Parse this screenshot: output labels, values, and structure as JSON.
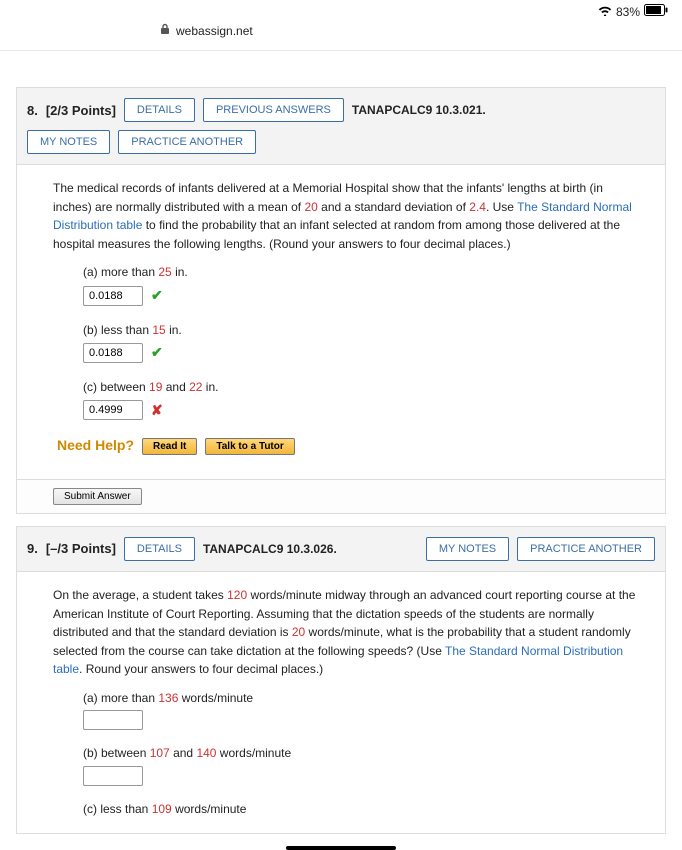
{
  "status": {
    "battery": "83%"
  },
  "address": "webassign.net",
  "buttons": {
    "details": "DETAILS",
    "previous_answers": "PREVIOUS ANSWERS",
    "my_notes": "MY NOTES",
    "practice_another": "PRACTICE ANOTHER"
  },
  "help": {
    "label": "Need Help?",
    "read": "Read It",
    "tutor": "Talk to a Tutor"
  },
  "submit_label": "Submit Answer",
  "q8": {
    "number": "8.",
    "points": "[2/3 Points]",
    "ref": "TANAPCALC9 10.3.021.",
    "text_pre": "The medical records of infants delivered at a Memorial Hospital show that the infants' lengths at birth (in inches) are normally distributed with a mean of ",
    "mean": "20",
    "text_mid1": " and a standard deviation of ",
    "sd": "2.4",
    "text_mid2": ". Use ",
    "link": "The Standard Normal Distribution table",
    "text_post": " to find the probability that an infant selected at random from among those delivered at the hospital measures the following lengths. (Round your answers to four decimal places.)",
    "a_pre": "(a) more than ",
    "a_val": "25",
    "a_unit": " in.",
    "a_ans": "0.0188",
    "b_pre": "(b) less than ",
    "b_val": "15",
    "b_unit": " in.",
    "b_ans": "0.0188",
    "c_pre": "(c) between ",
    "c_v1": "19",
    "c_mid": " and ",
    "c_v2": "22",
    "c_unit": " in.",
    "c_ans": "0.4999"
  },
  "q9": {
    "number": "9.",
    "points": "[–/3 Points]",
    "ref": "TANAPCALC9 10.3.026.",
    "t1": "On the average, a student takes ",
    "v1": "120",
    "t2": " words/minute midway through an advanced court reporting course at the American Institute of Court Reporting. Assuming that the dictation speeds of the students are normally distributed and that the standard deviation is ",
    "v2": "20",
    "t3": " words/minute, what is the probability that a student randomly selected from the course can take dictation at the following speeds? (Use ",
    "link": "The Standard Normal Distribution table",
    "t4": ". Round your answers to four decimal places.)",
    "a_pre": "(a) more than ",
    "a_val": "136",
    "a_unit": " words/minute",
    "b_pre": "(b) between ",
    "b_v1": "107",
    "b_mid": " and ",
    "b_v2": "140",
    "b_unit": " words/minute",
    "c_pre": "(c) less than ",
    "c_val": "109",
    "c_unit": " words/minute"
  }
}
